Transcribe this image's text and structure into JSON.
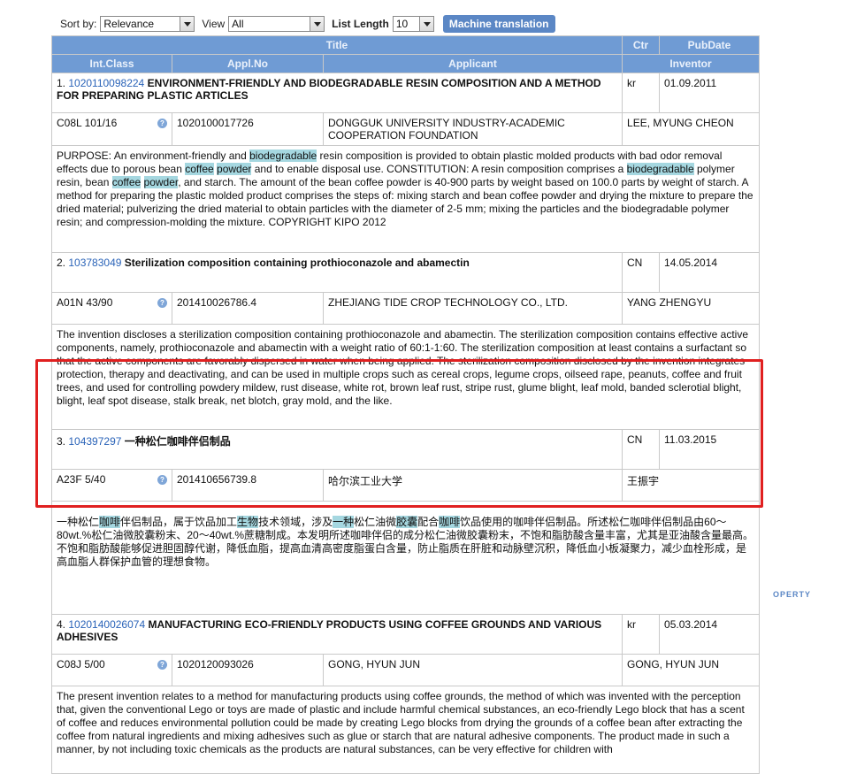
{
  "toolbar": {
    "sort_label": "Sort by:",
    "sort_value": "Relevance",
    "view_label": "View",
    "view_value": "All",
    "list_label": "List Length",
    "list_value": "10",
    "mt_button": "Machine translation"
  },
  "headers": {
    "title": "Title",
    "ctr": "Ctr",
    "pubdate": "PubDate",
    "intclass": "Int.Class",
    "applno": "Appl.No",
    "applicant": "Applicant",
    "inventor": "Inventor"
  },
  "results": [
    {
      "num": "1.",
      "id": "1020110098224",
      "title": "ENVIRONMENT-FRIENDLY AND BIODEGRADABLE RESIN COMPOSITION AND A METHOD FOR PREPARING PLASTIC ARTICLES",
      "ctr": "kr",
      "pubdate": "01.09.2011",
      "intclass": "C08L 101/16",
      "applno": "1020100017726",
      "applicant": "DONGGUK UNIVERSITY INDUSTRY-ACADEMIC COOPERATION FOUNDATION",
      "inventor": "LEE, MYUNG CHEON",
      "abstract": [
        {
          "t": "PURPOSE: An environment-friendly and "
        },
        {
          "t": "biodegradable",
          "h": true
        },
        {
          "t": " resin composition is provided to obtain plastic molded products with bad odor removal effects due to porous bean "
        },
        {
          "t": "coffee",
          "h": true
        },
        {
          "t": " "
        },
        {
          "t": "powder",
          "h": true
        },
        {
          "t": " and to enable disposal use. CONSTITUTION: A resin composition comprises a "
        },
        {
          "t": "biodegradable",
          "h": true
        },
        {
          "t": " polymer resin, bean "
        },
        {
          "t": "coffee",
          "h": true
        },
        {
          "t": " "
        },
        {
          "t": "powder",
          "h": true
        },
        {
          "t": ", and starch. The amount of the bean coffee powder is 40-900 parts by weight based on 100.0 parts by weight of starch. A method for preparing the plastic molded product comprises the steps of: mixing starch and bean coffee powder and drying the mixture to prepare the dried material; pulverizing the dried material to obtain particles with the diameter of 2-5 mm; mixing the particles and the biodegradable polymer resin; and compression-molding the mixture. COPYRIGHT KIPO 2012"
        }
      ]
    },
    {
      "num": "2.",
      "id": "103783049",
      "title": "Sterilization composition containing prothioconazole and abamectin",
      "ctr": "CN",
      "pubdate": "14.05.2014",
      "intclass": "A01N 43/90",
      "applno": "201410026786.4",
      "applicant": "ZHEJIANG TIDE CROP TECHNOLOGY CO., LTD.",
      "inventor": "YANG ZHENGYU",
      "abstract": [
        {
          "t": "The invention discloses a sterilization composition containing prothioconazole and abamectin. The sterilization composition contains effective active components, namely, prothioconazole and abamectin with a weight ratio of 60:1-1:60. The sterilization composition at least contains a surfactant so that the active components are favorably dispersed in water when being applied. The sterilization composition disclosed by the invention integrates protection, therapy and deactivating, and can be used in multiple crops such as cereal crops, legume crops, oilseed rape, peanuts, coffee and fruit trees, and used for controlling powdery mildew, rust disease, white rot, brown leaf rust, stripe rust, glume blight, leaf mold, banded sclerotial blight, blight, leaf spot disease, stalk break, net blotch, gray mold, and the like."
        }
      ]
    },
    {
      "num": "3.",
      "id": "104397297",
      "title": "一种松仁咖啡伴侣制品",
      "ctr": "CN",
      "pubdate": "11.03.2015",
      "intclass": "A23F 5/40",
      "applno": "201410656739.8",
      "applicant": "哈尔滨工业大学",
      "inventor": "王振宇",
      "abstract": [
        {
          "t": "一种松仁"
        },
        {
          "t": "咖啡",
          "h": true
        },
        {
          "t": "伴侣制品，属于饮品加工"
        },
        {
          "t": "生物",
          "h": true
        },
        {
          "t": "技术领域，涉及"
        },
        {
          "t": "一种",
          "h": true
        },
        {
          "t": "松仁油微"
        },
        {
          "t": "胶囊",
          "h": true
        },
        {
          "t": "配合"
        },
        {
          "t": "咖啡",
          "h": true
        },
        {
          "t": "饮品使用的咖啡伴侣制品。所述松仁咖啡伴侣制品由60～80wt.%松仁油微胶囊粉末、20～40wt.%蔗糖制成。本发明所述咖啡伴侣的成分松仁油微胶囊粉末，不饱和脂肪酸含量丰富，尤其是亚油酸含量最高。不饱和脂肪酸能够促进胆固醇代谢，降低血脂，提高血清高密度脂蛋白含量，防止脂质在肝脏和动脉壁沉积，降低血小板凝聚力，减少血栓形成，是高血脂人群保护血管的理想食物。"
        }
      ]
    },
    {
      "num": "4.",
      "id": "1020140026074",
      "title": "MANUFACTURING ECO-FRIENDLY PRODUCTS USING COFFEE GROUNDS AND VARIOUS ADHESIVES",
      "ctr": "kr",
      "pubdate": "05.03.2014",
      "intclass": "C08J 5/00",
      "applno": "1020120093026",
      "applicant": "GONG, HYUN JUN",
      "inventor": "GONG, HYUN JUN",
      "abstract": [
        {
          "t": "The present invention relates to a method for manufacturing products using coffee grounds, the method of which was invented with the perception that, given the conventional Lego or toys are made of plastic and include harmful chemical substances, an eco-friendly Lego block that has a scent of coffee and reduces environmental pollution could be made by creating Lego blocks from drying the grounds of a coffee bean after extracting the coffee from natural ingredients and mixing adhesives such as glue or starch that are natural adhesive components. The product made in such a manner, by not including toxic chemicals as the products are natural substances, can be very effective for children with"
        }
      ]
    }
  ],
  "watermark": "OPERTY"
}
